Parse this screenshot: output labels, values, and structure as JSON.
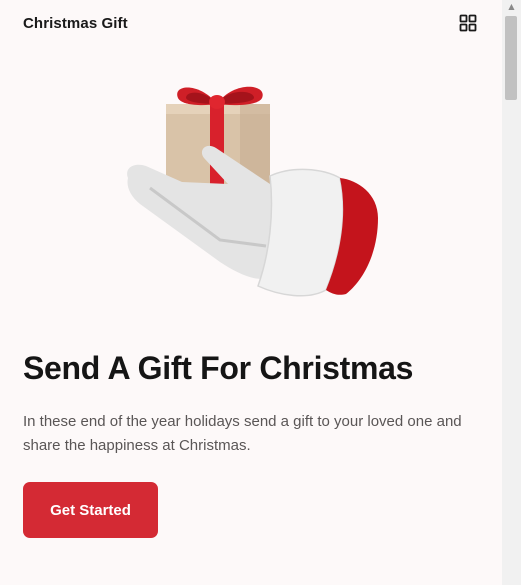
{
  "header": {
    "brand": "Christmas Gift",
    "menu_icon": "grid-menu-icon"
  },
  "hero": {
    "image_icon": "santa-hand-gift-illustration",
    "title": "Send A Gift For Christmas",
    "description": "In these end of the year holidays send a gift to your loved one and share the happiness at Christmas.",
    "cta_label": "Get Started"
  },
  "colors": {
    "accent": "#d42a34",
    "background": "#fdf9f9",
    "title": "#151515",
    "text": "#5a5656"
  },
  "scrollbar": {
    "up_arrow_icon": "scroll-up-arrow-icon"
  }
}
